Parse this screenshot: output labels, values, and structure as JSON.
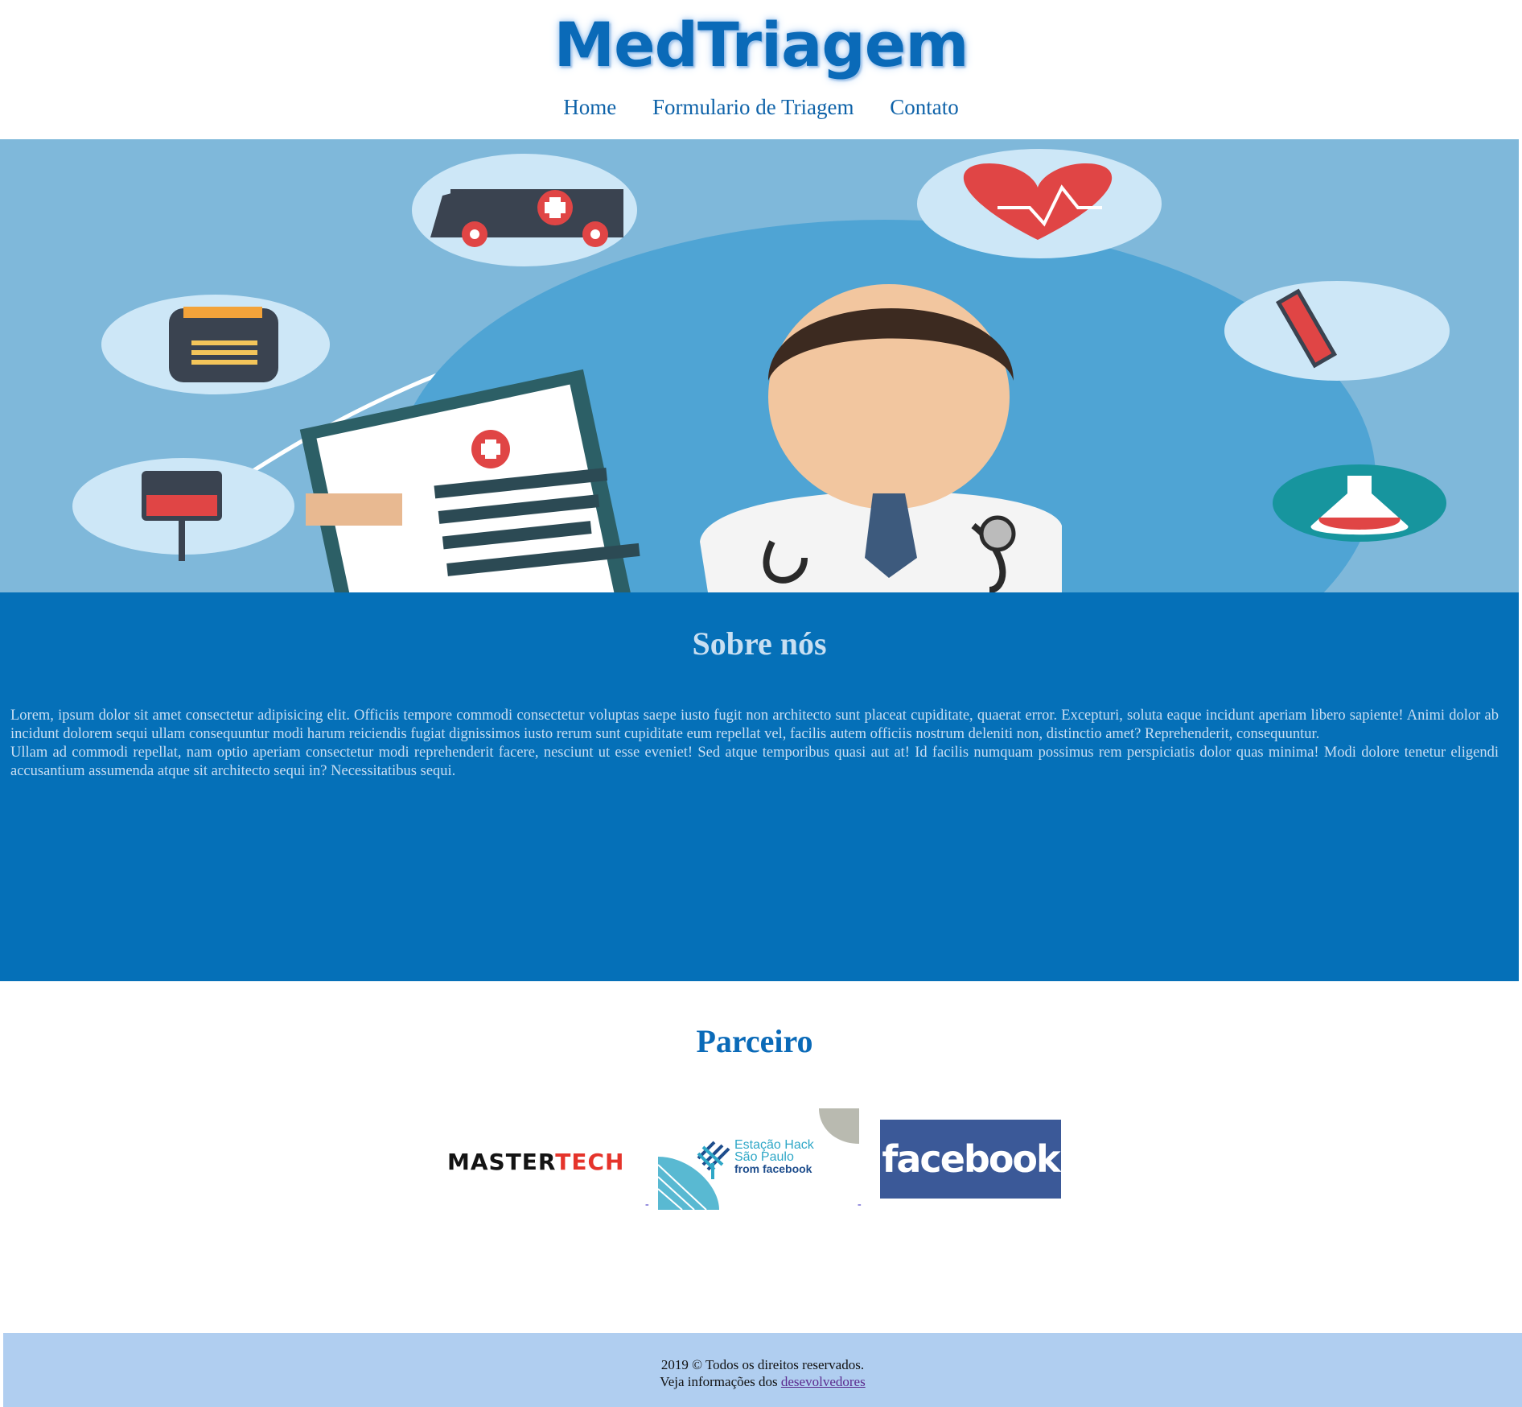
{
  "header": {
    "logo_text": "MedTriagem",
    "nav": [
      "Home",
      "Formulario de Triagem",
      "Contato"
    ]
  },
  "about": {
    "title": "Sobre nós",
    "paragraphs": [
      "Lorem, ipsum dolor sit amet consectetur adipisicing elit. Officiis tempore commodi consectetur voluptas saepe iusto fugit non architecto sunt placeat cupiditate, quaerat error. Excepturi, soluta eaque incidunt aperiam libero sapiente! Animi dolor ab incidunt dolorem sequi ullam consequuntur modi harum reiciendis fugiat dignissimos iusto rerum sunt cupiditate eum repellat vel, facilis autem officiis nostrum deleniti non, distinctio amet? Reprehenderit, consequuntur.",
      "Ullam ad commodi repellat, nam optio aperiam consectetur modi reprehenderit facere, nesciunt ut esse eveniet! Sed atque temporibus quasi aut at! Id facilis numquam possimus rem perspiciatis dolor quas minima! Modi dolore tenetur eligendi accusantium assumenda atque sit architecto sequi in? Necessitatibus sequi."
    ]
  },
  "partners": {
    "title": "Parceiro",
    "mastertech_part1": "MASTER",
    "mastertech_part2": "TECH",
    "estacao_lines": [
      "Estação Hack",
      "São Paulo",
      "from facebook"
    ],
    "facebook_text": "facebook"
  },
  "footer": {
    "line1": "2019 © Todos os direitos reservados.",
    "line2_prefix": "Veja informações dos",
    "link": "desevolvedores"
  },
  "colors": {
    "brand_blue": "#0570b8",
    "hero_bg": "#7fb8da",
    "footer_bg": "#b0cef0",
    "facebook_blue": "#3b5998"
  }
}
